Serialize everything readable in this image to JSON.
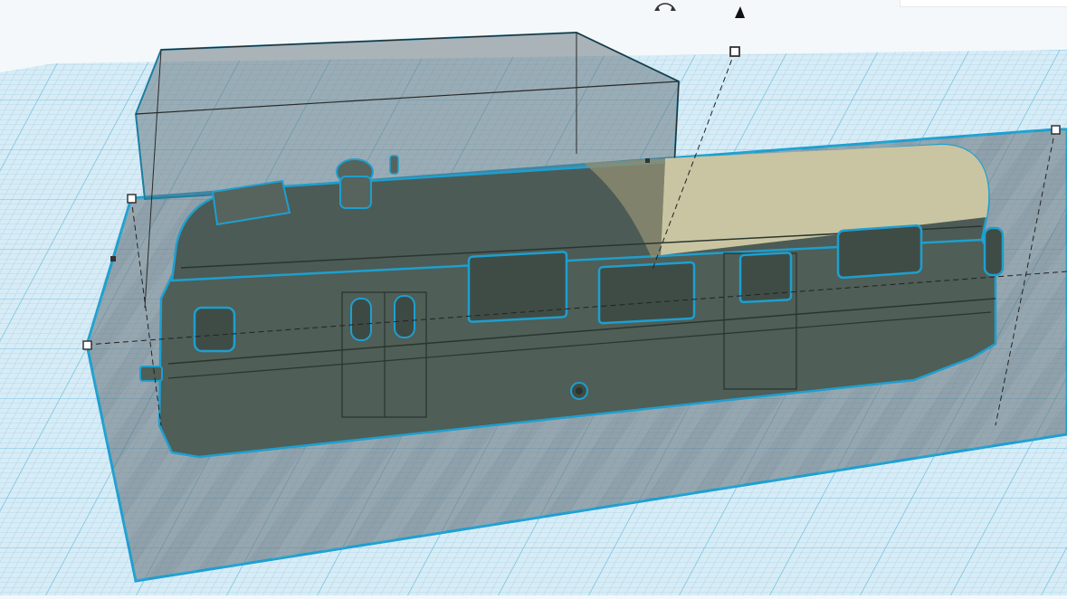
{
  "colors": {
    "workplane_bg": "#cfe7f3",
    "grid_minor": "#a9d2e6",
    "grid_major": "#6fbfe0",
    "selection_outline": "#1e9fcf",
    "body_fill": "#4f5e56",
    "roof_fill": "#c9c5a2",
    "ghost_box_fill": "#62727c",
    "handle_fill": "#ffffff",
    "handle_stroke": "#333333"
  },
  "viewport": {
    "selected_object": "railcar-body",
    "tools": {
      "rotate_handle_icon": "rotate-arc-icon",
      "lift_handle_icon": "cone-arrow-icon"
    }
  }
}
